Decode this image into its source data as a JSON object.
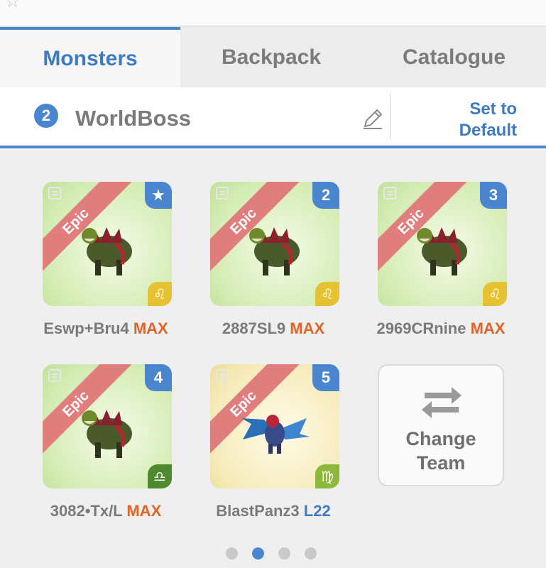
{
  "tabs": [
    "Monsters",
    "Backpack",
    "Catalogue"
  ],
  "team": {
    "number": "2",
    "name": "WorldBoss",
    "set_default_line1": "Set to",
    "set_default_line2": "Default"
  },
  "colors": {
    "accent": "#4a86cf",
    "max": "#e06327",
    "epic_ribbon": "#e07e7e"
  },
  "monsters": [
    {
      "name": "Eswp+Bru4",
      "level": "MAX",
      "rarity": "Epic",
      "slot": "★",
      "sign": "♌"
    },
    {
      "name": "2887SL9",
      "level": "MAX",
      "rarity": "Epic",
      "slot": "2",
      "sign": "♌"
    },
    {
      "name": "2969CRnine",
      "level": "MAX",
      "rarity": "Epic",
      "slot": "3",
      "sign": "♌"
    },
    {
      "name": "3082•Tx/L",
      "level": "MAX",
      "rarity": "Epic",
      "slot": "4",
      "sign": "♎"
    },
    {
      "name": "BlastPanz3",
      "level": "L22",
      "rarity": "Epic",
      "slot": "5",
      "sign": "♍"
    }
  ],
  "change_team": {
    "line1": "Change",
    "line2": "Team"
  },
  "pagination": {
    "pages": 4,
    "current": 2
  }
}
